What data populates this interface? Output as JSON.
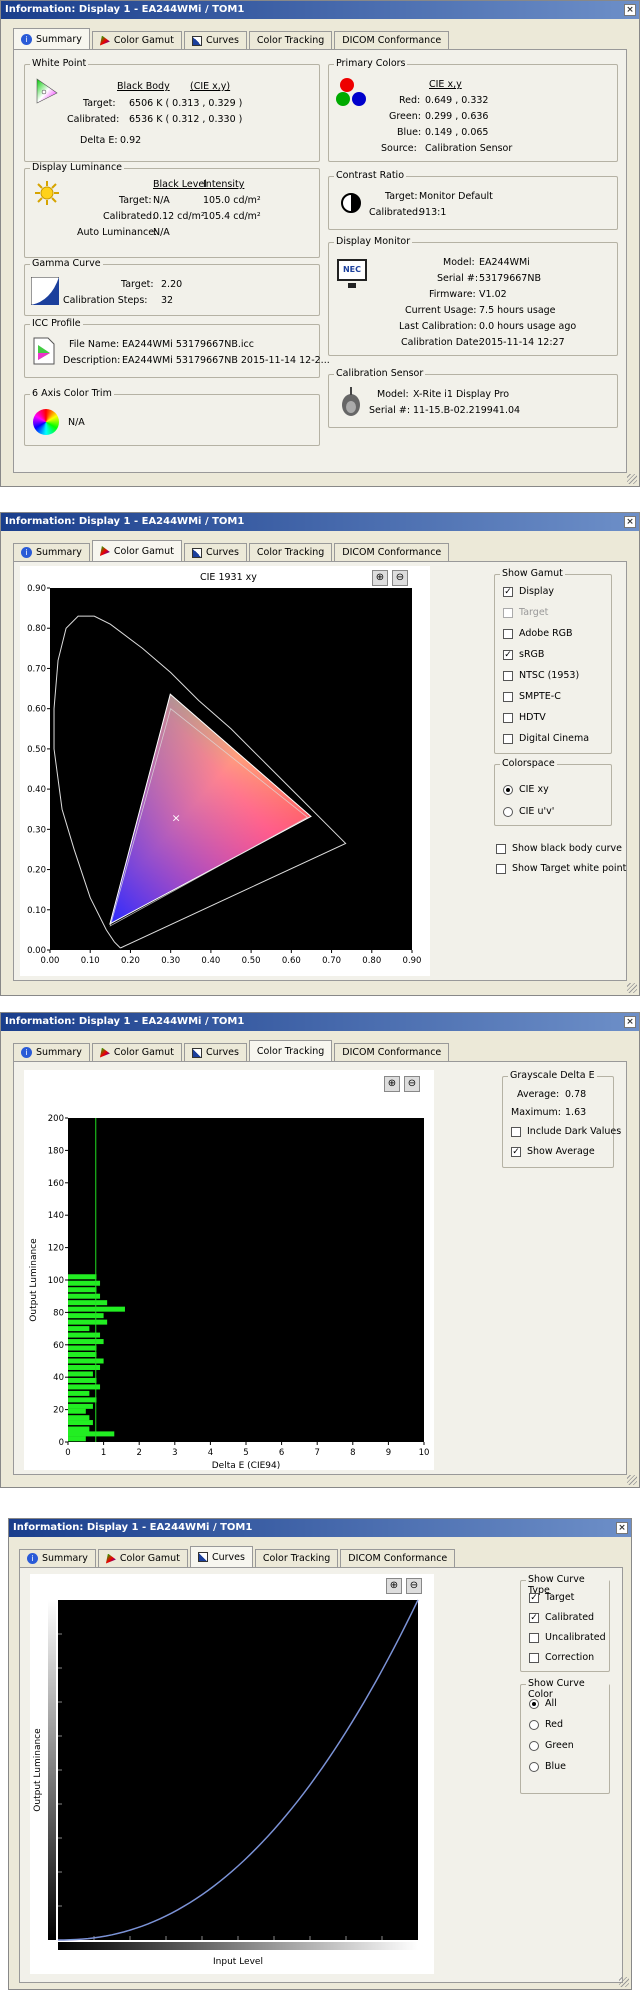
{
  "windows": {
    "summary_title": "Information: Display 1 - EA244WMi / TOM1",
    "gamut_title": "Information: Display 1 - EA244WMi / TOM1",
    "tracking_title": "Information: Display 1 - EA244WMi / TOM1",
    "curves_title": "Information: Display 1 - EA244WMi / TOM1",
    "close_glyph": "×"
  },
  "tabs": [
    "Summary",
    "Color Gamut",
    "Curves",
    "Color Tracking",
    "DICOM Conformance"
  ],
  "summary": {
    "white_point": {
      "title": "White Point",
      "col1": "Black Body",
      "col2": "(CIE x,y)",
      "target_label": "Target:",
      "target_value": "6506 K  ( 0.313 , 0.329 )",
      "calibrated_label": "Calibrated:",
      "calibrated_value": "6536 K  ( 0.312 , 0.330 )",
      "delta_label": "Delta E:",
      "delta_value": "0.92"
    },
    "luminance": {
      "title": "Display Luminance",
      "col1": "Black Level",
      "col2": "Intensity",
      "target_label": "Target:",
      "target_black": "N/A",
      "target_int": "105.0 cd/m²",
      "cal_label": "Calibrated:",
      "cal_black": "0.12 cd/m²",
      "cal_int": "105.4 cd/m²",
      "auto_label": "Auto Luminance:",
      "auto_value": "N/A"
    },
    "gamma": {
      "title": "Gamma Curve",
      "target_label": "Target:",
      "target_value": "2.20",
      "steps_label": "Calibration Steps:",
      "steps_value": "32"
    },
    "icc": {
      "title": "ICC Profile",
      "file_label": "File Name:",
      "file_value": "EA244WMi 53179667NB.icc",
      "desc_label": "Description:",
      "desc_value": "EA244WMi 53179667NB 2015-11-14 12-2..."
    },
    "six_axis": {
      "title": "6 Axis Color Trim",
      "value": "N/A"
    },
    "primaries": {
      "title": "Primary Colors",
      "col": "CIE x,y",
      "red_label": "Red:",
      "red_value": "0.649 , 0.332",
      "green_label": "Green:",
      "green_value": "0.299 , 0.636",
      "blue_label": "Blue:",
      "blue_value": "0.149 , 0.065",
      "source_label": "Source:",
      "source_value": "Calibration Sensor"
    },
    "contrast": {
      "title": "Contrast Ratio",
      "target_label": "Target:",
      "target_value": "Monitor Default",
      "cal_label": "Calibrated:",
      "cal_value": "913:1"
    },
    "monitor": {
      "title": "Display Monitor",
      "logo": "NEC",
      "model_label": "Model:",
      "model_value": "EA244WMi",
      "serial_label": "Serial #:",
      "serial_value": "53179667NB",
      "fw_label": "Firmware:",
      "fw_value": "V1.02",
      "usage_label": "Current Usage:",
      "usage_value": "7.5 hours usage",
      "last_label": "Last Calibration:",
      "last_value": "0.0 hours usage ago",
      "date_label": "Calibration Date:",
      "date_value": "2015-11-14 12:27"
    },
    "sensor": {
      "title": "Calibration Sensor",
      "model_label": "Model:",
      "model_value": "X-Rite i1 Display Pro",
      "serial_label": "Serial #:",
      "serial_value": "11-15.B-02.219941.04"
    }
  },
  "gamut": {
    "chart_title": "CIE 1931 xy",
    "show_gamut_title": "Show Gamut",
    "options": [
      {
        "label": "Display",
        "checked": true,
        "disabled": false
      },
      {
        "label": "Target",
        "checked": false,
        "disabled": true
      },
      {
        "label": "Adobe RGB",
        "checked": false,
        "disabled": false
      },
      {
        "label": "sRGB",
        "checked": true,
        "disabled": false
      },
      {
        "label": "NTSC (1953)",
        "checked": false,
        "disabled": false
      },
      {
        "label": "SMPTE-C",
        "checked": false,
        "disabled": false
      },
      {
        "label": "HDTV",
        "checked": false,
        "disabled": false
      },
      {
        "label": "Digital Cinema",
        "checked": false,
        "disabled": false
      }
    ],
    "colorspace_title": "Colorspace",
    "cs_xy": "CIE xy",
    "cs_uv": "CIE u'v'",
    "black_body": "Show black body curve",
    "target_wp": "Show Target white point",
    "x_ticks": [
      "0.00",
      "0.10",
      "0.20",
      "0.30",
      "0.40",
      "0.50",
      "0.60",
      "0.70",
      "0.80",
      "0.90"
    ],
    "y_ticks": [
      "0.00",
      "0.10",
      "0.20",
      "0.30",
      "0.40",
      "0.50",
      "0.60",
      "0.70",
      "0.80",
      "0.90"
    ]
  },
  "tracking": {
    "group_title": "Grayscale Delta E",
    "avg_label": "Average:",
    "avg_value": "0.78",
    "max_label": "Maximum:",
    "max_value": "1.63",
    "include_dark": "Include Dark Values",
    "show_avg": "Show Average",
    "xlabel": "Delta E (CIE94)",
    "ylabel": "Output Luminance",
    "x_ticks": [
      "0",
      "1",
      "2",
      "3",
      "4",
      "5",
      "6",
      "7",
      "8",
      "9",
      "10"
    ],
    "y_ticks": [
      "0",
      "20",
      "40",
      "60",
      "80",
      "100",
      "120",
      "140",
      "160",
      "180",
      "200"
    ]
  },
  "curves": {
    "type_title": "Show Curve Type",
    "type_options": [
      {
        "label": "Target",
        "checked": true
      },
      {
        "label": "Calibrated",
        "checked": true
      },
      {
        "label": "Uncalibrated",
        "checked": false
      },
      {
        "label": "Correction",
        "checked": false
      }
    ],
    "color_title": "Show Curve Color",
    "color_options": [
      {
        "label": "All",
        "checked": true
      },
      {
        "label": "Red",
        "checked": false
      },
      {
        "label": "Green",
        "checked": false
      },
      {
        "label": "Blue",
        "checked": false
      }
    ],
    "xlabel": "Input Level",
    "ylabel": "Output Luminance"
  },
  "chart_data": [
    {
      "type": "scatter",
      "title": "CIE 1931 xy",
      "xlabel": "",
      "ylabel": "",
      "xlim": [
        0,
        0.9
      ],
      "ylim": [
        0,
        0.9
      ],
      "series": [
        {
          "values": [
            [
              0.649,
              0.332
            ],
            [
              0.299,
              0.636
            ],
            [
              0.149,
              0.065
            ]
          ]
        },
        {
          "values": [
            [
              0.64,
              0.33
            ],
            [
              0.3,
              0.6
            ],
            [
              0.15,
              0.06
            ]
          ]
        },
        {
          "values": [
            [
              0.312,
              0.33
            ]
          ]
        }
      ]
    },
    {
      "type": "bar",
      "xlabel": "Delta E (CIE94)",
      "ylabel": "Output Luminance",
      "xlim": [
        0,
        10
      ],
      "ylim": [
        0,
        200
      ],
      "average": 0.78,
      "levels": [
        2,
        5,
        8,
        12,
        15,
        19,
        22,
        26,
        30,
        34,
        38,
        42,
        46,
        50,
        54,
        58,
        62,
        66,
        70,
        74,
        78,
        82,
        86,
        90,
        94,
        98,
        102
      ],
      "values": [
        0.5,
        1.3,
        0.6,
        0.7,
        0.6,
        0.5,
        0.7,
        0.8,
        0.6,
        0.9,
        0.8,
        0.7,
        0.9,
        1.0,
        0.8,
        0.8,
        1.0,
        0.9,
        0.6,
        1.1,
        1.0,
        1.6,
        1.1,
        0.9,
        0.8,
        0.9,
        0.8
      ]
    },
    {
      "type": "line",
      "xlabel": "Input Level",
      "ylabel": "Output Luminance",
      "xlim": [
        0,
        1
      ],
      "ylim": [
        0,
        1
      ],
      "series": [
        {
          "gamma": 2.2
        }
      ]
    }
  ]
}
